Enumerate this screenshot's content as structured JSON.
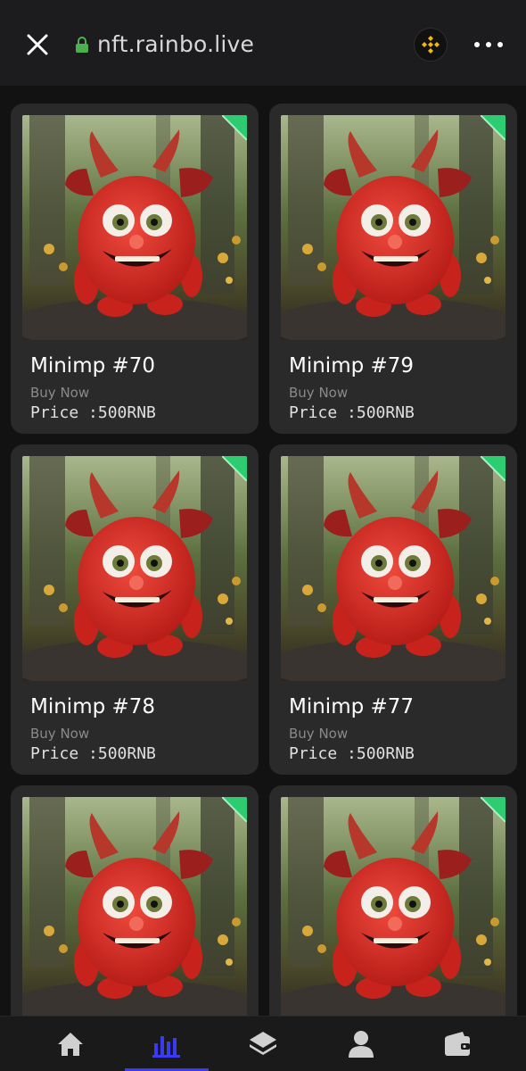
{
  "browser": {
    "url": "nft.rainbo.live",
    "close_icon": "close-icon",
    "lock_icon": "lock-icon",
    "wallet_icon": "bnb-icon",
    "menu_icon": "more-horizontal-icon"
  },
  "cards": [
    {
      "title": "Minimp #70",
      "action": "Buy Now",
      "price": "Price :500RNB"
    },
    {
      "title": "Minimp #79",
      "action": "Buy Now",
      "price": "Price :500RNB"
    },
    {
      "title": "Minimp #78",
      "action": "Buy Now",
      "price": "Price :500RNB"
    },
    {
      "title": "Minimp #77",
      "action": "Buy Now",
      "price": "Price :500RNB"
    },
    {
      "title": "",
      "action": "",
      "price": ""
    },
    {
      "title": "",
      "action": "",
      "price": ""
    }
  ],
  "nav": {
    "items": [
      {
        "icon": "home-icon"
      },
      {
        "icon": "chart-icon",
        "active": true
      },
      {
        "icon": "layers-icon"
      },
      {
        "icon": "user-icon"
      },
      {
        "icon": "wallet-icon"
      }
    ],
    "active_color": "#3a3af0"
  },
  "colors": {
    "background": "#121212",
    "card": "#2b2a2a",
    "badge": "#2ecc71",
    "lock": "#4caf50",
    "bnb": "#f0b90b"
  }
}
